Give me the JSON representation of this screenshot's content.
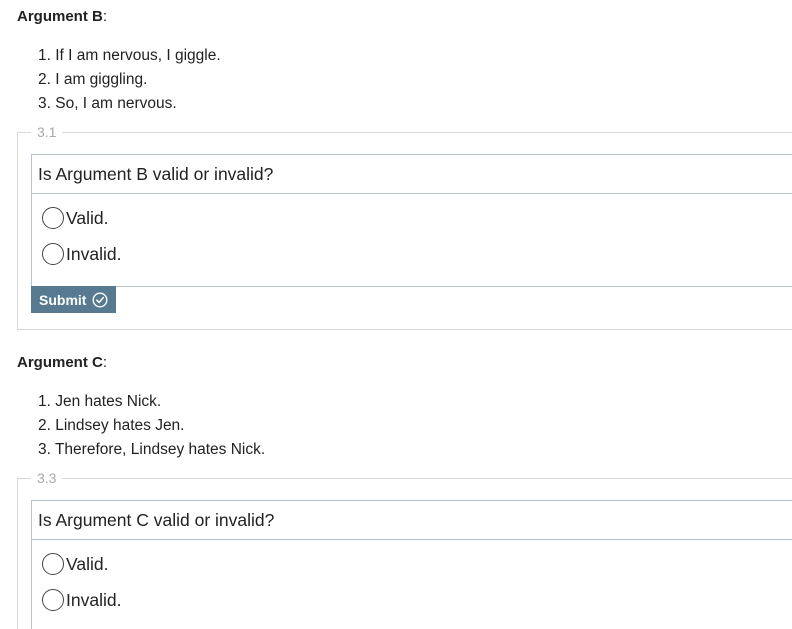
{
  "arguments": [
    {
      "heading": "Argument B",
      "colon": ":",
      "premises": [
        "1. If I am nervous, I giggle.",
        "2. I am giggling.",
        "3. So, I am nervous."
      ],
      "question_number": "3.1",
      "prompt": "Is Argument B valid or invalid?",
      "options": [
        "Valid.",
        "Invalid."
      ],
      "submit_label": "Submit"
    },
    {
      "heading": "Argument C",
      "colon": ":",
      "premises": [
        "1. Jen hates Nick.",
        "2. Lindsey hates Jen.",
        "3. Therefore, Lindsey hates Nick."
      ],
      "question_number": "3.3",
      "prompt": "Is Argument C valid or invalid?",
      "options": [
        "Valid.",
        "Invalid."
      ]
    }
  ],
  "colors": {
    "submit_bg": "#577a90",
    "border_outer": "#d9d9d9",
    "border_inner": "#b7c4cd",
    "question_number": "#a9a9a9"
  },
  "icons": {
    "submit": "check-circle-icon",
    "option": "radio-button"
  }
}
